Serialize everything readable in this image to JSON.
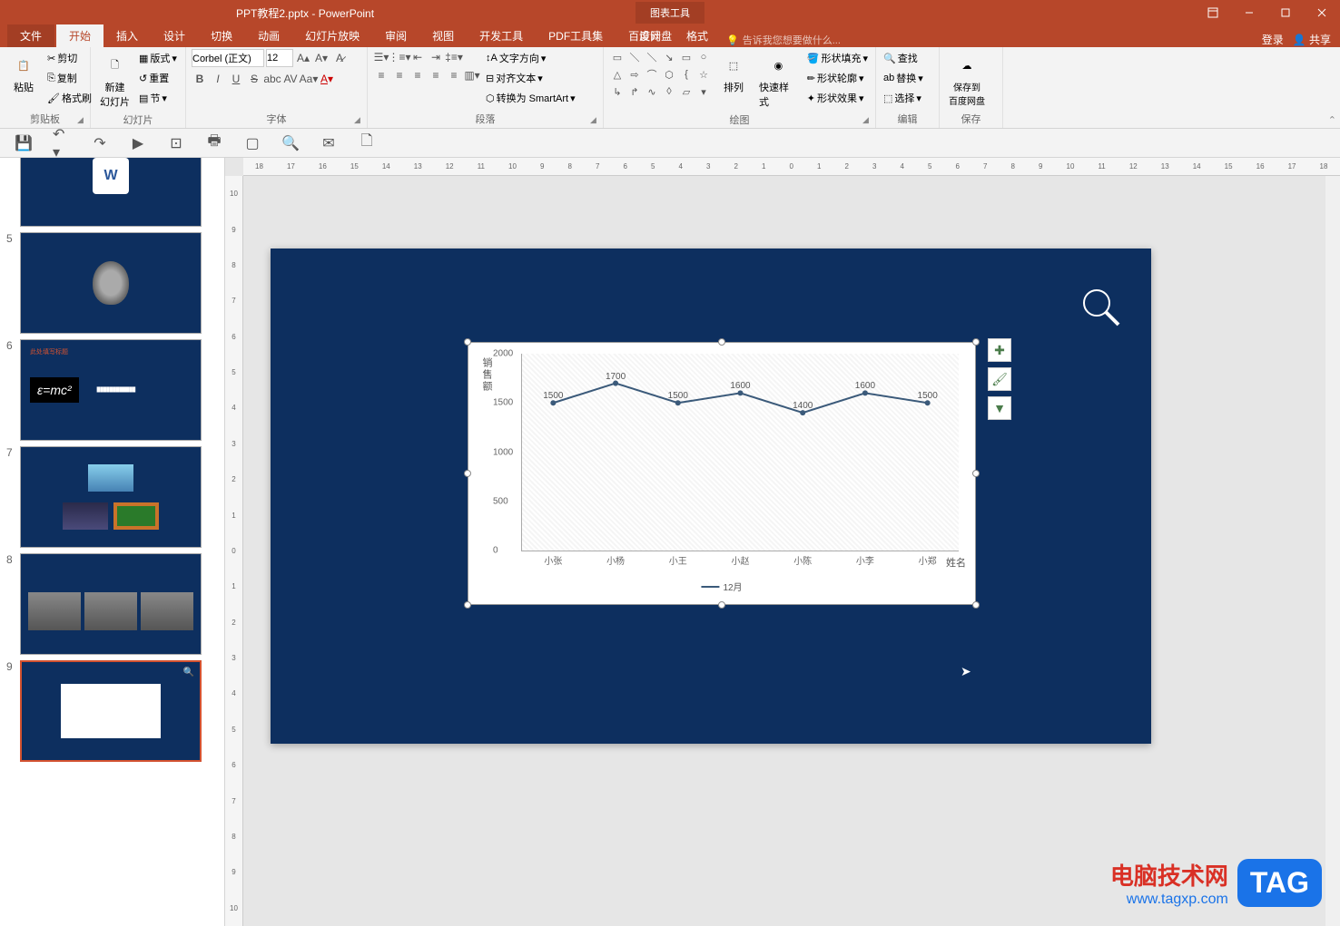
{
  "window": {
    "title": "PPT教程2.pptx - PowerPoint",
    "chart_tools": "图表工具",
    "login": "登录",
    "share": "共享"
  },
  "tabs": {
    "file": "文件",
    "home": "开始",
    "insert": "插入",
    "design": "设计",
    "transitions": "切换",
    "animations": "动画",
    "slideshow": "幻灯片放映",
    "review": "审阅",
    "view": "视图",
    "developer": "开发工具",
    "pdf": "PDF工具集",
    "baidu": "百度网盘",
    "chart_design": "设计",
    "chart_format": "格式",
    "tellme": "告诉我您想要做什么..."
  },
  "ribbon": {
    "clipboard": {
      "label": "剪贴板",
      "paste": "粘贴",
      "cut": "剪切",
      "copy": "复制",
      "painter": "格式刷"
    },
    "slides": {
      "label": "幻灯片",
      "new": "新建\n幻灯片",
      "layout": "版式",
      "reset": "重置",
      "section": "节"
    },
    "font": {
      "label": "字体",
      "name": "Corbel (正文)",
      "size": "12"
    },
    "paragraph": {
      "label": "段落",
      "text_dir": "文字方向",
      "align_text": "对齐文本",
      "smartart": "转换为 SmartArt"
    },
    "drawing": {
      "label": "绘图",
      "arrange": "排列",
      "quickstyle": "快速样式",
      "fill": "形状填充",
      "outline": "形状轮廓",
      "effects": "形状效果"
    },
    "editing": {
      "label": "编辑",
      "find": "查找",
      "replace": "替换",
      "select": "选择"
    },
    "save": {
      "label": "保存",
      "baidu": "保存到\n百度网盘"
    }
  },
  "slides_panel": [
    {
      "num": "",
      "type": "word"
    },
    {
      "num": "5",
      "type": "einstein"
    },
    {
      "num": "6",
      "type": "emc",
      "title": "此处填写标题",
      "formula": "ε=mc²"
    },
    {
      "num": "7",
      "type": "pics"
    },
    {
      "num": "8",
      "type": "history"
    },
    {
      "num": "9",
      "type": "chart",
      "active": true
    }
  ],
  "chart_data": {
    "type": "line",
    "y_title": "销售额",
    "x_title": "姓名",
    "legend": "12月",
    "categories": [
      "小张",
      "小杨",
      "小王",
      "小赵",
      "小陈",
      "小李",
      "小郑"
    ],
    "values": [
      1500,
      1700,
      1500,
      1600,
      1400,
      1600,
      1500
    ],
    "ylim": [
      0,
      2000
    ],
    "y_ticks": [
      0,
      500,
      1000,
      1500,
      2000
    ]
  },
  "ruler_h": [
    "18",
    "17",
    "16",
    "15",
    "14",
    "13",
    "12",
    "11",
    "10",
    "9",
    "8",
    "7",
    "6",
    "5",
    "4",
    "3",
    "2",
    "1",
    "0",
    "1",
    "2",
    "3",
    "4",
    "5",
    "6",
    "7",
    "8",
    "9",
    "10",
    "11",
    "12",
    "13",
    "14",
    "15",
    "16",
    "17",
    "18"
  ],
  "ruler_v": [
    "10",
    "9",
    "8",
    "7",
    "6",
    "5",
    "4",
    "3",
    "2",
    "1",
    "0",
    "1",
    "2",
    "3",
    "4",
    "5",
    "6",
    "7",
    "8",
    "9",
    "10"
  ],
  "watermark": {
    "line1": "电脑技术网",
    "line2": "www.tagxp.com",
    "tag": "TAG"
  }
}
